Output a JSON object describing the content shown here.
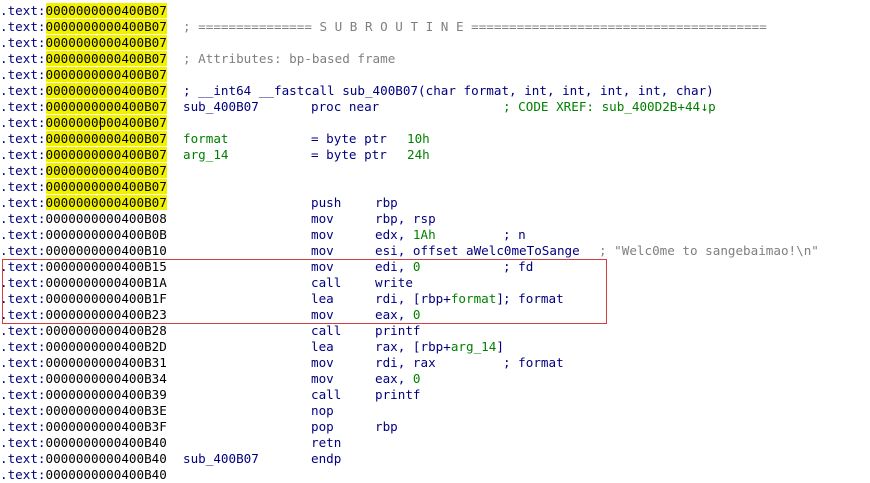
{
  "segment": ".text:",
  "lines": [
    {
      "addr": "0000000000400B07",
      "hl": true,
      "kind": "plain",
      "text": ""
    },
    {
      "addr": "0000000000400B07",
      "hl": true,
      "kind": "comment",
      "text": "; =============== S U B R O U T I N E ======================================="
    },
    {
      "addr": "0000000000400B07",
      "hl": true,
      "kind": "plain",
      "text": ""
    },
    {
      "addr": "0000000000400B07",
      "hl": true,
      "kind": "comment",
      "text": "; Attributes: bp-based frame"
    },
    {
      "addr": "0000000000400B07",
      "hl": true,
      "kind": "plain",
      "text": ""
    },
    {
      "addr": "0000000000400B07",
      "hl": true,
      "kind": "proto",
      "text": "; __int64 __fastcall sub_400B07(char format, int, int, int, int, char)"
    },
    {
      "addr": "0000000000400B07",
      "hl": true,
      "kind": "proc",
      "label": "sub_400B07",
      "mnem": "proc near",
      "cmt": "; CODE XREF: sub_400D2B+44",
      "arrow": "↓p"
    },
    {
      "addr": "0000000000400B07",
      "hl": true,
      "kind": "cursor",
      "text": ""
    },
    {
      "addr": "0000000000400B07",
      "hl": true,
      "kind": "var",
      "label": "format",
      "mnem": "= byte ptr",
      "ops": "10h"
    },
    {
      "addr": "0000000000400B07",
      "hl": true,
      "kind": "var",
      "label": "arg_14",
      "mnem": "= byte ptr",
      "ops": "24h"
    },
    {
      "addr": "0000000000400B07",
      "hl": true,
      "kind": "plain",
      "text": ""
    },
    {
      "addr": "0000000000400B07",
      "hl": true,
      "kind": "plain",
      "text": ""
    },
    {
      "addr": "0000000000400B07",
      "hl": true,
      "kind": "ins",
      "mnem": "push",
      "ops": "rbp"
    },
    {
      "addr": "0000000000400B08",
      "hl": false,
      "kind": "ins",
      "mnem": "mov",
      "ops": "rbp, rsp"
    },
    {
      "addr": "0000000000400B0B",
      "hl": false,
      "kind": "ins",
      "mnem": "mov",
      "ops": "edx, 1Ah",
      "cmt": "; n"
    },
    {
      "addr": "0000000000400B10",
      "hl": false,
      "kind": "ins",
      "mnem": "mov",
      "ops": "esi, offset aWelc0meToSange",
      "cmt": "; \"Welc0me to sangebaimao!\\n\""
    },
    {
      "addr": "0000000000400B15",
      "hl": false,
      "kind": "ins",
      "mnem": "mov",
      "ops": "edi, 0",
      "cmt": "; fd"
    },
    {
      "addr": "0000000000400B1A",
      "hl": false,
      "kind": "ins",
      "mnem": "call",
      "ops": "write"
    },
    {
      "addr": "0000000000400B1F",
      "hl": false,
      "kind": "ins",
      "mnem": "lea",
      "ops": "rdi, [rbp+format]",
      "cmt": "; format"
    },
    {
      "addr": "0000000000400B23",
      "hl": false,
      "kind": "ins",
      "mnem": "mov",
      "ops": "eax, 0"
    },
    {
      "addr": "0000000000400B28",
      "hl": false,
      "kind": "ins",
      "mnem": "call",
      "ops": "printf"
    },
    {
      "addr": "0000000000400B2D",
      "hl": false,
      "kind": "ins",
      "mnem": "lea",
      "ops": "rax, [rbp+arg_14]"
    },
    {
      "addr": "0000000000400B31",
      "hl": false,
      "kind": "ins",
      "mnem": "mov",
      "ops": "rdi, rax",
      "cmt": "; format"
    },
    {
      "addr": "0000000000400B34",
      "hl": false,
      "kind": "ins",
      "mnem": "mov",
      "ops": "eax, 0"
    },
    {
      "addr": "0000000000400B39",
      "hl": false,
      "kind": "ins",
      "mnem": "call",
      "ops": "printf"
    },
    {
      "addr": "0000000000400B3E",
      "hl": false,
      "kind": "ins",
      "mnem": "nop",
      "ops": ""
    },
    {
      "addr": "0000000000400B3F",
      "hl": false,
      "kind": "ins",
      "mnem": "pop",
      "ops": "rbp"
    },
    {
      "addr": "0000000000400B40",
      "hl": false,
      "kind": "ins",
      "mnem": "retn",
      "ops": ""
    },
    {
      "addr": "0000000000400B40",
      "hl": false,
      "kind": "endp",
      "label": "sub_400B07",
      "mnem": "endp"
    },
    {
      "addr": "0000000000400B40",
      "hl": false,
      "kind": "plain",
      "text": ""
    }
  ],
  "colors": {
    "highlight": "#f2f200",
    "selection_border": "#d04040",
    "comment": "#008000",
    "code": "#000080"
  }
}
